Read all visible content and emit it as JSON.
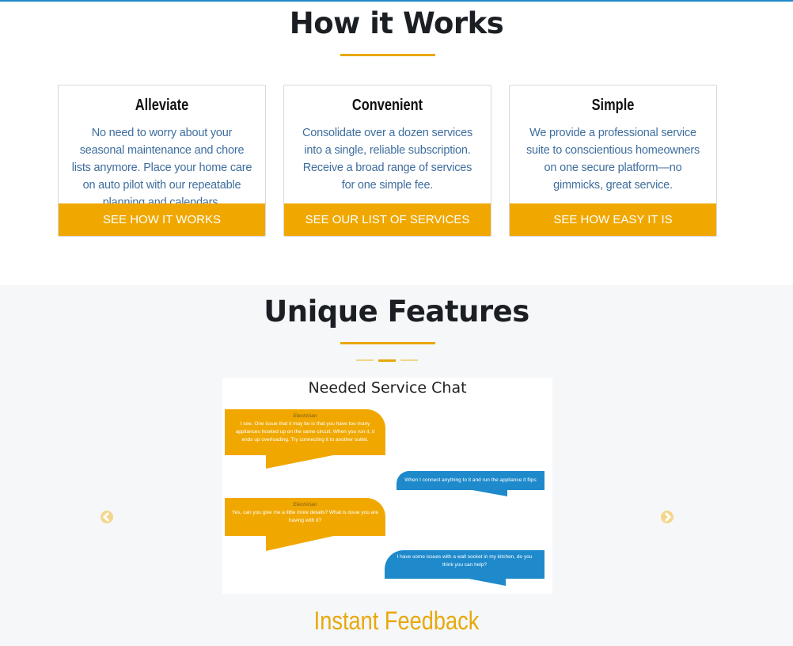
{
  "how_it_works": {
    "title": "How it Works",
    "cards": [
      {
        "title": "Alleviate",
        "body": "No need to worry about your seasonal maintenance and chore lists anymore. Place your home care on auto pilot with our repeatable planning and calendars.",
        "button": "SEE HOW IT WORKS"
      },
      {
        "title": "Convenient",
        "body": "Consolidate over a dozen services into a single, reliable subscription. Receive a broad range of services for one simple fee.",
        "button": "SEE OUR LIST OF SERVICES"
      },
      {
        "title": "Simple",
        "body": "We provide a professional service suite to conscientious homeowners on one secure platform—no gimmicks, great service.",
        "button": "SEE HOW EASY IT IS"
      }
    ]
  },
  "features": {
    "title": "Unique Features",
    "carousel": {
      "slide_title": "Needed Service Chat",
      "messages": [
        {
          "speaker": "Electrician",
          "text": "I see. One issue that it may be is that you have too many appliances hooked up on the same circuit. When you run it, it ends up overloading. Try connecting it to another outlet."
        },
        {
          "speaker": "",
          "text": "When I connect anything to it and run the appliance it flips the breaker."
        },
        {
          "speaker": "Electrician",
          "text": "Yes, can you give me a little more details? What is issue you are having with it?"
        },
        {
          "speaker": "",
          "text": "I have some issues with a wall socket in my kitchen, do you think you can help?"
        }
      ],
      "caption": "Instant Feedback",
      "colors": {
        "accent": "#f0a800",
        "blue": "#1e8acb"
      }
    }
  }
}
